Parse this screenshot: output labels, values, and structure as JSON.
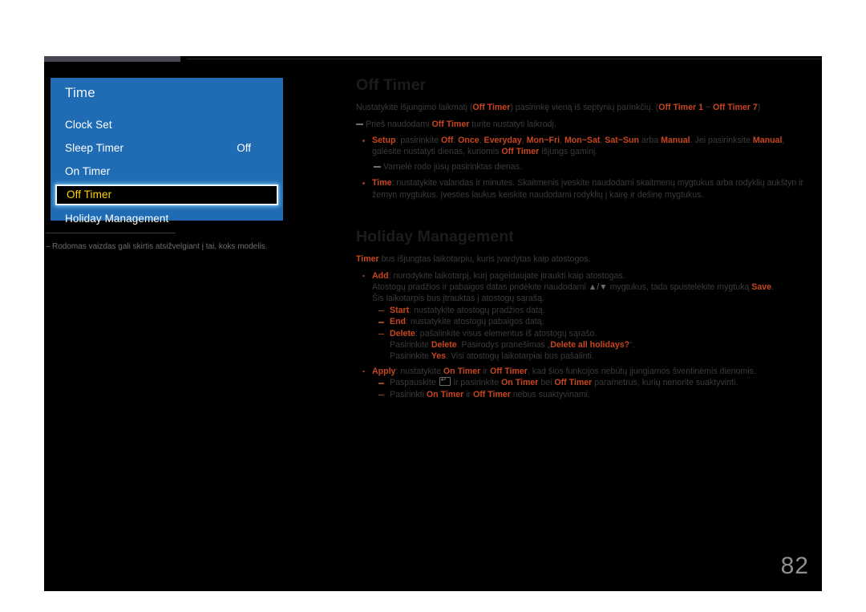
{
  "page": {
    "number": "82",
    "footnote": "Rodomas vaizdas gali skirtis atsižvelgiant į tai, koks modelis."
  },
  "osd": {
    "title": "Time",
    "items": [
      {
        "label": "Clock Set",
        "value": ""
      },
      {
        "label": "Sleep Timer",
        "value": "Off"
      },
      {
        "label": "On Timer",
        "value": ""
      },
      {
        "label": "Off Timer",
        "value": "",
        "selected": true
      },
      {
        "label": "Holiday Management",
        "value": ""
      }
    ]
  },
  "content": {
    "off_timer": {
      "title": "Off Timer",
      "intro_1": "Nustatykite išjungimo laikmatį (",
      "intro_term_1": "Off Timer",
      "intro_2": ") pasirinkę vieną iš septynių parinkčių. (",
      "intro_term_2": "Off Timer 1",
      "intro_3": " ~ ",
      "intro_term_3": "Off Timer 7",
      "intro_4": ")",
      "note_a_1": "Prieš naudodami ",
      "note_a_term": "Off Timer",
      "note_a_2": " turite nustatyti laikrodį.",
      "setup_term": "Setup",
      "setup_1": ": pasirinkite ",
      "setup_opt_1": "Off",
      "setup_sep_1": ", ",
      "setup_opt_2": "Once",
      "setup_sep_2": ", ",
      "setup_opt_3": "Everyday",
      "setup_sep_3": ", ",
      "setup_opt_4": "Mon~Fri",
      "setup_sep_4": ", ",
      "setup_opt_5": "Mon~Sat",
      "setup_sep_5": ", ",
      "setup_opt_6": "Sat~Sun",
      "setup_sep_6": " arba ",
      "setup_opt_7": "Manual",
      "setup_2": ". Jei pasirinksite ",
      "setup_opt_8": "Manual",
      "setup_3": ", galėsite nustatyti dienas, kuriomis ",
      "setup_opt_9": "Off Timer",
      "setup_4": " išjungs gaminį.",
      "note_b": "Varnelė rodo jūsų pasirinktas dienas.",
      "time_term": "Time",
      "time_text": ": nustatykite valandas ir minutes. Skaitmenis įveskite naudodami skaitmenų mygtukus arba rodyklių aukštyn ir žemyn mygtukus. Įvesties laukus keiskite naudodami rodyklių į kairę ir dešinę mygtukus."
    },
    "holiday": {
      "title": "Holiday Management",
      "intro_term": "Timer",
      "intro_text": " bus išjungtas laikotarpiu, kuris įvardytas kaip atostogos.",
      "add_term": "Add",
      "add_text": ": nurodykite laikotarpį, kurį pageidaujate įtraukti kaip atostogas.",
      "add_line2_a": "Atostogų pradžios ir pabaigos datas pridėkite naudodami ",
      "add_line2_arrows": "▲/▼",
      "add_line2_b": " mygtukus, tada spustelėkite mygtuką ",
      "add_line2_term": "Save",
      "add_line2_c": ".",
      "add_line3": "Šis laikotarpis bus įtrauktas į atostogų sąrašą.",
      "start_term": "Start",
      "start_text": ": nustatykite atostogų pradžios datą.",
      "end_term": "End",
      "end_text": ": nustatykite atostogų pabaigos datą.",
      "delete_term": "Delete",
      "delete_text": ": pašalinkite visus elementus iš atostogų sąrašo.",
      "delete_line2_a": "Pasirinkite ",
      "delete_line2_term1": "Delete",
      "delete_line2_b": ". Pasirodys pranešimas „",
      "delete_line2_term2": "Delete all holidays?",
      "delete_line2_c": "“.",
      "delete_line3_a": "Pasirinkite ",
      "delete_line3_term": "Yes",
      "delete_line3_b": ". Visi atostogų laikotarpiai bus pašalinti.",
      "apply_term": "Apply",
      "apply_a": ": nustatykite ",
      "apply_term2": "On Timer",
      "apply_b": " ir ",
      "apply_term3": "Off Timer",
      "apply_c": ", kad šios funkcijos nebūtų įjungiamos šventinėmis dienomis.",
      "apply_sub1_a": "Paspauskite ",
      "apply_sub1_b": " ir pasirinkite ",
      "apply_sub1_term1": "On Timer",
      "apply_sub1_c": " bei ",
      "apply_sub1_term2": "Off Timer",
      "apply_sub1_d": " parametrus, kurių nenorite suaktyvinti.",
      "apply_sub2_a": "Pasirinkti ",
      "apply_sub2_term1": "On Timer",
      "apply_sub2_b": " ir ",
      "apply_sub2_term2": "Off Timer",
      "apply_sub2_c": " nebus suaktyvinami."
    }
  }
}
